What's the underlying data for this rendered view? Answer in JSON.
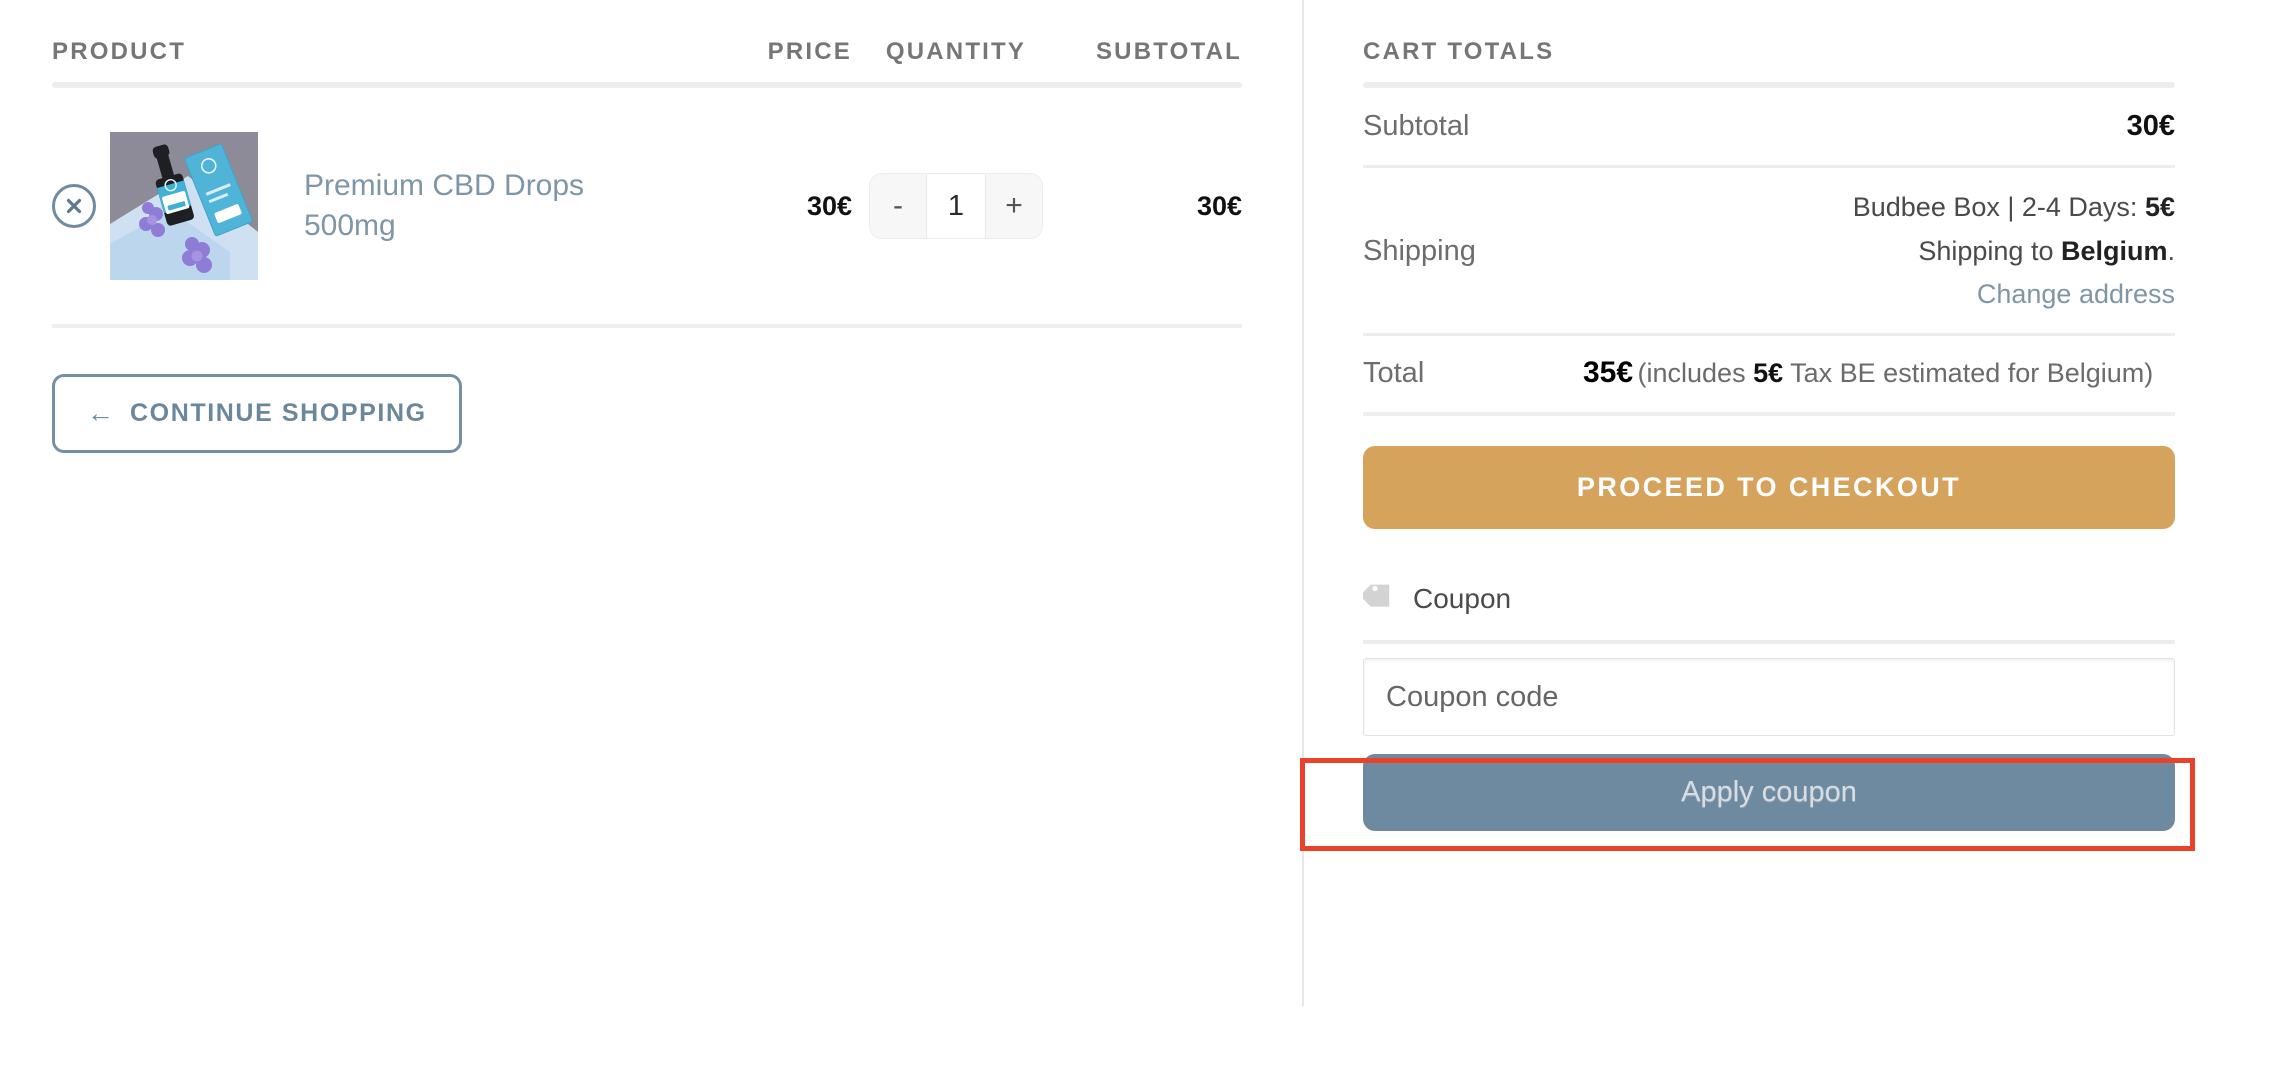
{
  "cart_table": {
    "headers": {
      "product": "PRODUCT",
      "price": "PRICE",
      "quantity": "QUANTITY",
      "subtotal": "SUBTOTAL"
    },
    "rows": [
      {
        "remove_icon": "close-circle-icon",
        "thumbnail_alt": "premium-cbd-drops-bottle-and-box",
        "name": "Premium CBD Drops 500mg",
        "price": "30€",
        "quantity": "1",
        "decrement_label": "-",
        "increment_label": "+",
        "subtotal": "30€"
      }
    ]
  },
  "continue_shopping": {
    "arrow": "←",
    "label": "CONTINUE SHOPPING"
  },
  "cart_totals": {
    "title": "CART TOTALS",
    "subtotal": {
      "label": "Subtotal",
      "value": "30€"
    },
    "shipping": {
      "label": "Shipping",
      "method": "Budbee Box | 2-4 Days:",
      "method_price": "5€",
      "destination_prefix": "Shipping to ",
      "destination": "Belgium",
      "destination_suffix": ".",
      "change_address_link": "Change address"
    },
    "total": {
      "label": "Total",
      "amount": "35€",
      "note_prefix": "(includes ",
      "tax_amount": "5€",
      "note_suffix": " Tax BE estimated for Belgium)"
    },
    "checkout_button": "PROCEED TO CHECKOUT"
  },
  "coupon": {
    "toggle_label": "Coupon",
    "tag_icon": "tag-icon",
    "input_placeholder": "Coupon code",
    "input_value": "",
    "apply_button": "Apply coupon"
  },
  "colors": {
    "checkout_accent": "#d6a35c",
    "apply_button": "#6e8aa0",
    "link_blue": "#7e96a6",
    "highlight_red": "#e8432a",
    "header_gray": "#767676"
  }
}
